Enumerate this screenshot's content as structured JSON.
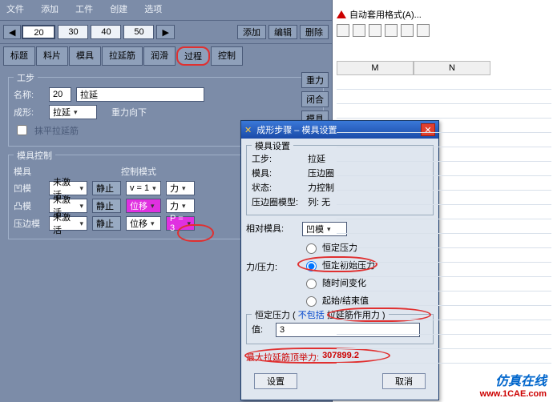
{
  "menu": {
    "file": "文件",
    "add": "添加",
    "work": "工件",
    "create": "创建",
    "options": "选项"
  },
  "step_tabs": [
    "20",
    "30",
    "40",
    "50"
  ],
  "step_actions": {
    "add": "添加",
    "edit": "编辑",
    "delete": "删除"
  },
  "cat_tabs": [
    "标题",
    "料片",
    "模具",
    "拉延筋",
    "润滑",
    "过程",
    "控制"
  ],
  "gongbu": {
    "group": "工步",
    "name_label": "名称:",
    "name_step": "20",
    "name_val": "拉延",
    "shape_label": "成形:",
    "shape_val": "拉延",
    "grav_label": "重力向下",
    "flatten": "抹平拉延筋",
    "side_redo": "重力",
    "side_close": "闭合",
    "side_tool": "模具"
  },
  "mkz": {
    "group": "模具控制",
    "tool_label": "模具",
    "mode_label": "控制模式",
    "rows": [
      {
        "name": "凹模",
        "a": "未激活",
        "b": "静止",
        "c": "v = 1",
        "d": "力"
      },
      {
        "name": "凸模",
        "a": "未激活",
        "b": "静止",
        "c": "位移",
        "d": "力"
      },
      {
        "name": "压边模",
        "a": "未激活",
        "b": "静止",
        "c": "位移",
        "d": "P = 3"
      }
    ]
  },
  "dialog": {
    "title": "成形步骤 – 模具设置",
    "info_group": "模具设置",
    "info": {
      "步骤": "拉延",
      "模具:": "压边圈",
      "状态:": "力控制",
      "压边圈模型:": "列: 无"
    },
    "relative_label": "相对模具:",
    "relative_val": "凹模",
    "force_label": "力/压力:",
    "radios": [
      "恒定压力",
      "恒定初始压力",
      "随时间变化",
      "起始/结束值"
    ],
    "const_p_row": "恒定压力  (",
    "not_incl": "不包括",
    "draw_eff": "拉延筋作用力 )",
    "val_label": "值:",
    "val_value": "3",
    "max_label": "最大拉延筋顶举力:",
    "max_value": "307899.2",
    "set": "设置",
    "cancel": "取消"
  },
  "excel": {
    "auto_format": "自动套用格式(A)...",
    "cols": [
      "M",
      "N"
    ]
  },
  "watermark": {
    "l1": "仿真在线",
    "l2": "www.1CAE.com"
  }
}
